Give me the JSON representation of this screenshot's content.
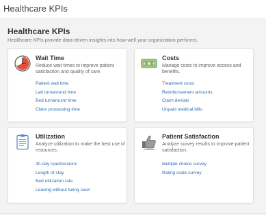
{
  "window": {
    "title": "Healthcare KPIs"
  },
  "header": {
    "title": "Healthcare KPIs",
    "subtitle": "Healthcare KPIs provide data-driven insights into how well your organization performs."
  },
  "cards": [
    {
      "title": "Wait Time",
      "icon": "clock-icon",
      "description": "Reduce wait times to improve patient satisfaction and quality of care.",
      "links": [
        "Patient wait time",
        "Lab turnaround time",
        "Bed turnaround time",
        "Claim processing time"
      ]
    },
    {
      "title": "Costs",
      "icon": "money-icon",
      "description": "Manage costs to improve access and benefits.",
      "links": [
        "Treatment costs",
        "Reimbursement amounts",
        "Claim denials",
        "Unpaid medical bills"
      ]
    },
    {
      "title": "Utilization",
      "icon": "clipboard-icon",
      "description": "Analyze utilization to make the best use of resources.",
      "links": [
        "30-day readmissions",
        "Length of stay",
        "Bed utilization rate",
        "Leaving without being seen"
      ]
    },
    {
      "title": "Patient Satisfaction",
      "icon": "thumbs-up-icon",
      "description": "Analyze survey results to improve patient satisfaction.",
      "links": [
        "Multiple choice survey",
        "Rating scale survey"
      ]
    }
  ],
  "colors": {
    "link": "#2b6bb0",
    "clock_face": "#e2513b",
    "money_green": "#7ba35a",
    "clipboard_blue": "#5b87c5",
    "thumb_gray": "#8a8a8a"
  }
}
